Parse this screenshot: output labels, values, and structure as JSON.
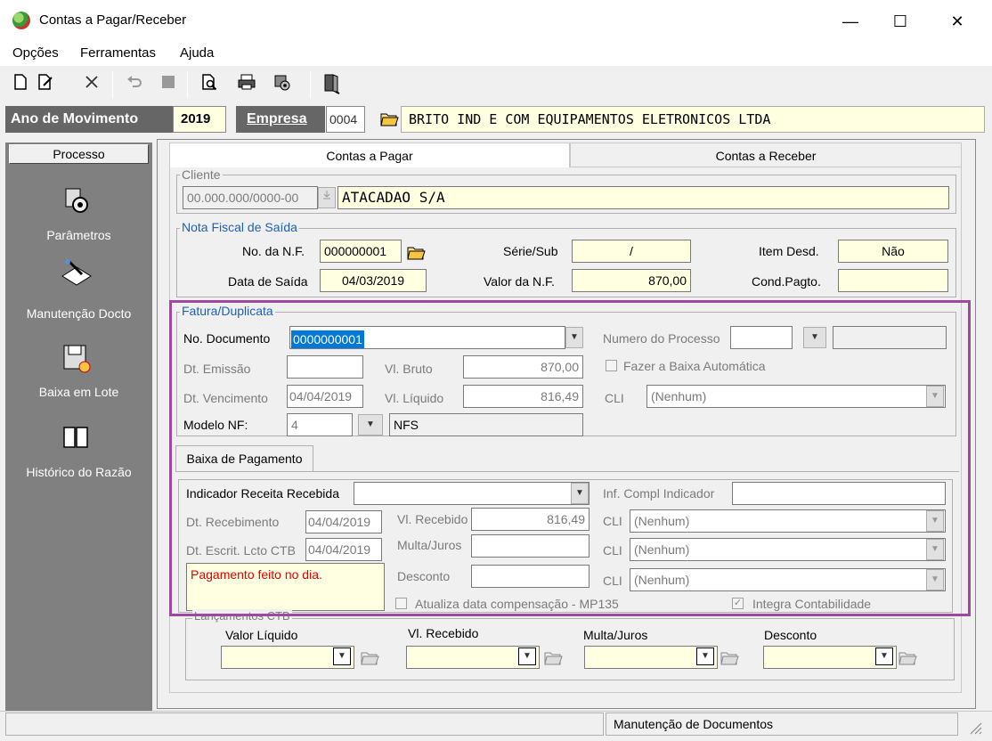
{
  "window": {
    "title": "Contas a Pagar/Receber",
    "min": "—",
    "max": "☐",
    "close": "✕"
  },
  "menu": [
    "Opções",
    "Ferramentas",
    "Ajuda"
  ],
  "header": {
    "year_label": "Ano de Movimento",
    "year": "2019",
    "company_label": "Empresa",
    "company_code": "0004",
    "company_name": "BRITO IND E COM EQUIPAMENTOS ELETRONICOS LTDA"
  },
  "sidebar": {
    "title": "Processo",
    "items": [
      "Parâmetros",
      "Manutenção Docto",
      "Baixa em Lote",
      "Histórico do Razão"
    ]
  },
  "tabs": [
    "Contas a Pagar",
    "Contas a Receber"
  ],
  "cliente": {
    "legend": "Cliente",
    "cnpj": "00.000.000/0000-00",
    "name": "ATACADAO S/A"
  },
  "nf": {
    "legend": "Nota Fiscal de Saída",
    "numero_label": "No. da N.F.",
    "numero": "000000001",
    "serie_label": "Série/Sub",
    "serie": "/",
    "item_label": "Item Desd.",
    "item": "Não",
    "data_label": "Data de Saída",
    "data": "04/03/2019",
    "valor_label": "Valor da N.F.",
    "valor": "870,00",
    "cond_label": "Cond.Pagto.",
    "cond": ""
  },
  "fatura": {
    "legend": "Fatura/Duplicata",
    "doc_label": "No. Documento",
    "doc": "0000000001",
    "proc_label": "Numero do Processo",
    "emissao_label": "Dt. Emissão",
    "emissao": "",
    "bruto_label": "Vl. Bruto",
    "bruto": "870,00",
    "baixa_auto_label": "Fazer a Baixa Automática",
    "venc_label": "Dt. Vencimento",
    "venc": "04/04/2019",
    "liquido_label": "Vl. Líquido",
    "liquido": "816,49",
    "cli_label": "CLI",
    "cli_value": "(Nenhum)",
    "modelo_label": "Modelo NF:",
    "modelo": "4",
    "modelo_desc": "NFS"
  },
  "baixa": {
    "tab": "Baixa de Pagamento",
    "indicador_label": "Indicador Receita Recebida",
    "inf_label": "Inf. Compl Indicador",
    "receb_label": "Dt. Recebimento",
    "receb": "04/04/2019",
    "vlreceb_label": "Vl. Recebido",
    "vlreceb": "816,49",
    "escrit_label": "Dt. Escrit. Lcto CTB",
    "escrit": "04/04/2019",
    "multa_label": "Multa/Juros",
    "desconto_label": "Desconto",
    "obs": "Pagamento feito no dia.",
    "cli_label": "CLI",
    "cli_value": "(Nenhum)",
    "atualiza_label": "Atualiza data compensação - MP135",
    "integra_label": "Integra Contabilidade"
  },
  "lancamentos": {
    "legend": "Lançamentos CTB",
    "cols": [
      "Valor Líquido",
      "Vl. Recebido",
      "Multa/Juros",
      "Desconto"
    ]
  },
  "status": {
    "right": "Manutenção de Documentos"
  }
}
